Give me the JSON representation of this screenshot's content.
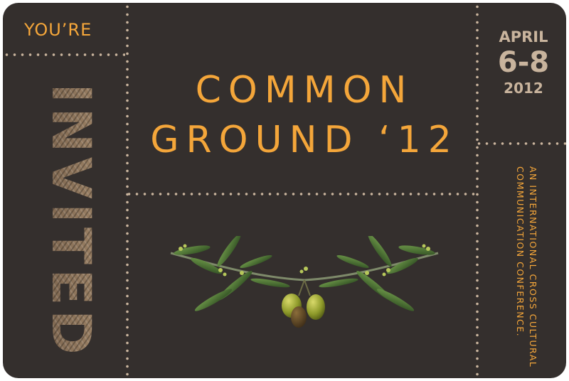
{
  "header": {
    "youre": "YOU’RE",
    "invited": "INVITED"
  },
  "event": {
    "title_line1": "COMMON",
    "title_line2": "GROUND ‘12"
  },
  "date": {
    "month": "APRIL",
    "days": "6-8",
    "year": "2012"
  },
  "tagline": {
    "line1": "AN INTERNATIONAL CROSS CULTURAL",
    "line2": "COMMUNICATION CONFERENCE."
  },
  "colors": {
    "background": "#342f2d",
    "accent": "#f4a63a",
    "muted": "#c9b49d",
    "texture": "#8b7058"
  },
  "decoration": {
    "image": "olive-branch-icon"
  }
}
